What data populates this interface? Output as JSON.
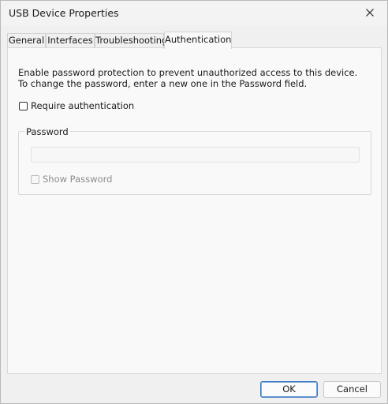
{
  "window": {
    "title": "USB Device Properties"
  },
  "tabs": [
    {
      "label": "General",
      "active": false
    },
    {
      "label": "Interfaces",
      "active": false
    },
    {
      "label": "Troubleshooting",
      "active": false
    },
    {
      "label": "Authentication",
      "active": true
    }
  ],
  "panel": {
    "description": "Enable password protection to prevent unauthorized access to this device. To change the password, enter a new one in the Password field.",
    "require_auth": {
      "label": "Require authentication",
      "checked": false
    },
    "password_group": {
      "legend": "Password",
      "input_value": "",
      "disabled": true,
      "show_password": {
        "label": "Show Password",
        "checked": false,
        "disabled": true
      }
    }
  },
  "buttons": {
    "ok": "OK",
    "cancel": "Cancel"
  },
  "icons": {
    "close": "close-icon"
  },
  "colors": {
    "default_button_border": "#3c78c4",
    "disabled_text": "#8c8c8c"
  }
}
